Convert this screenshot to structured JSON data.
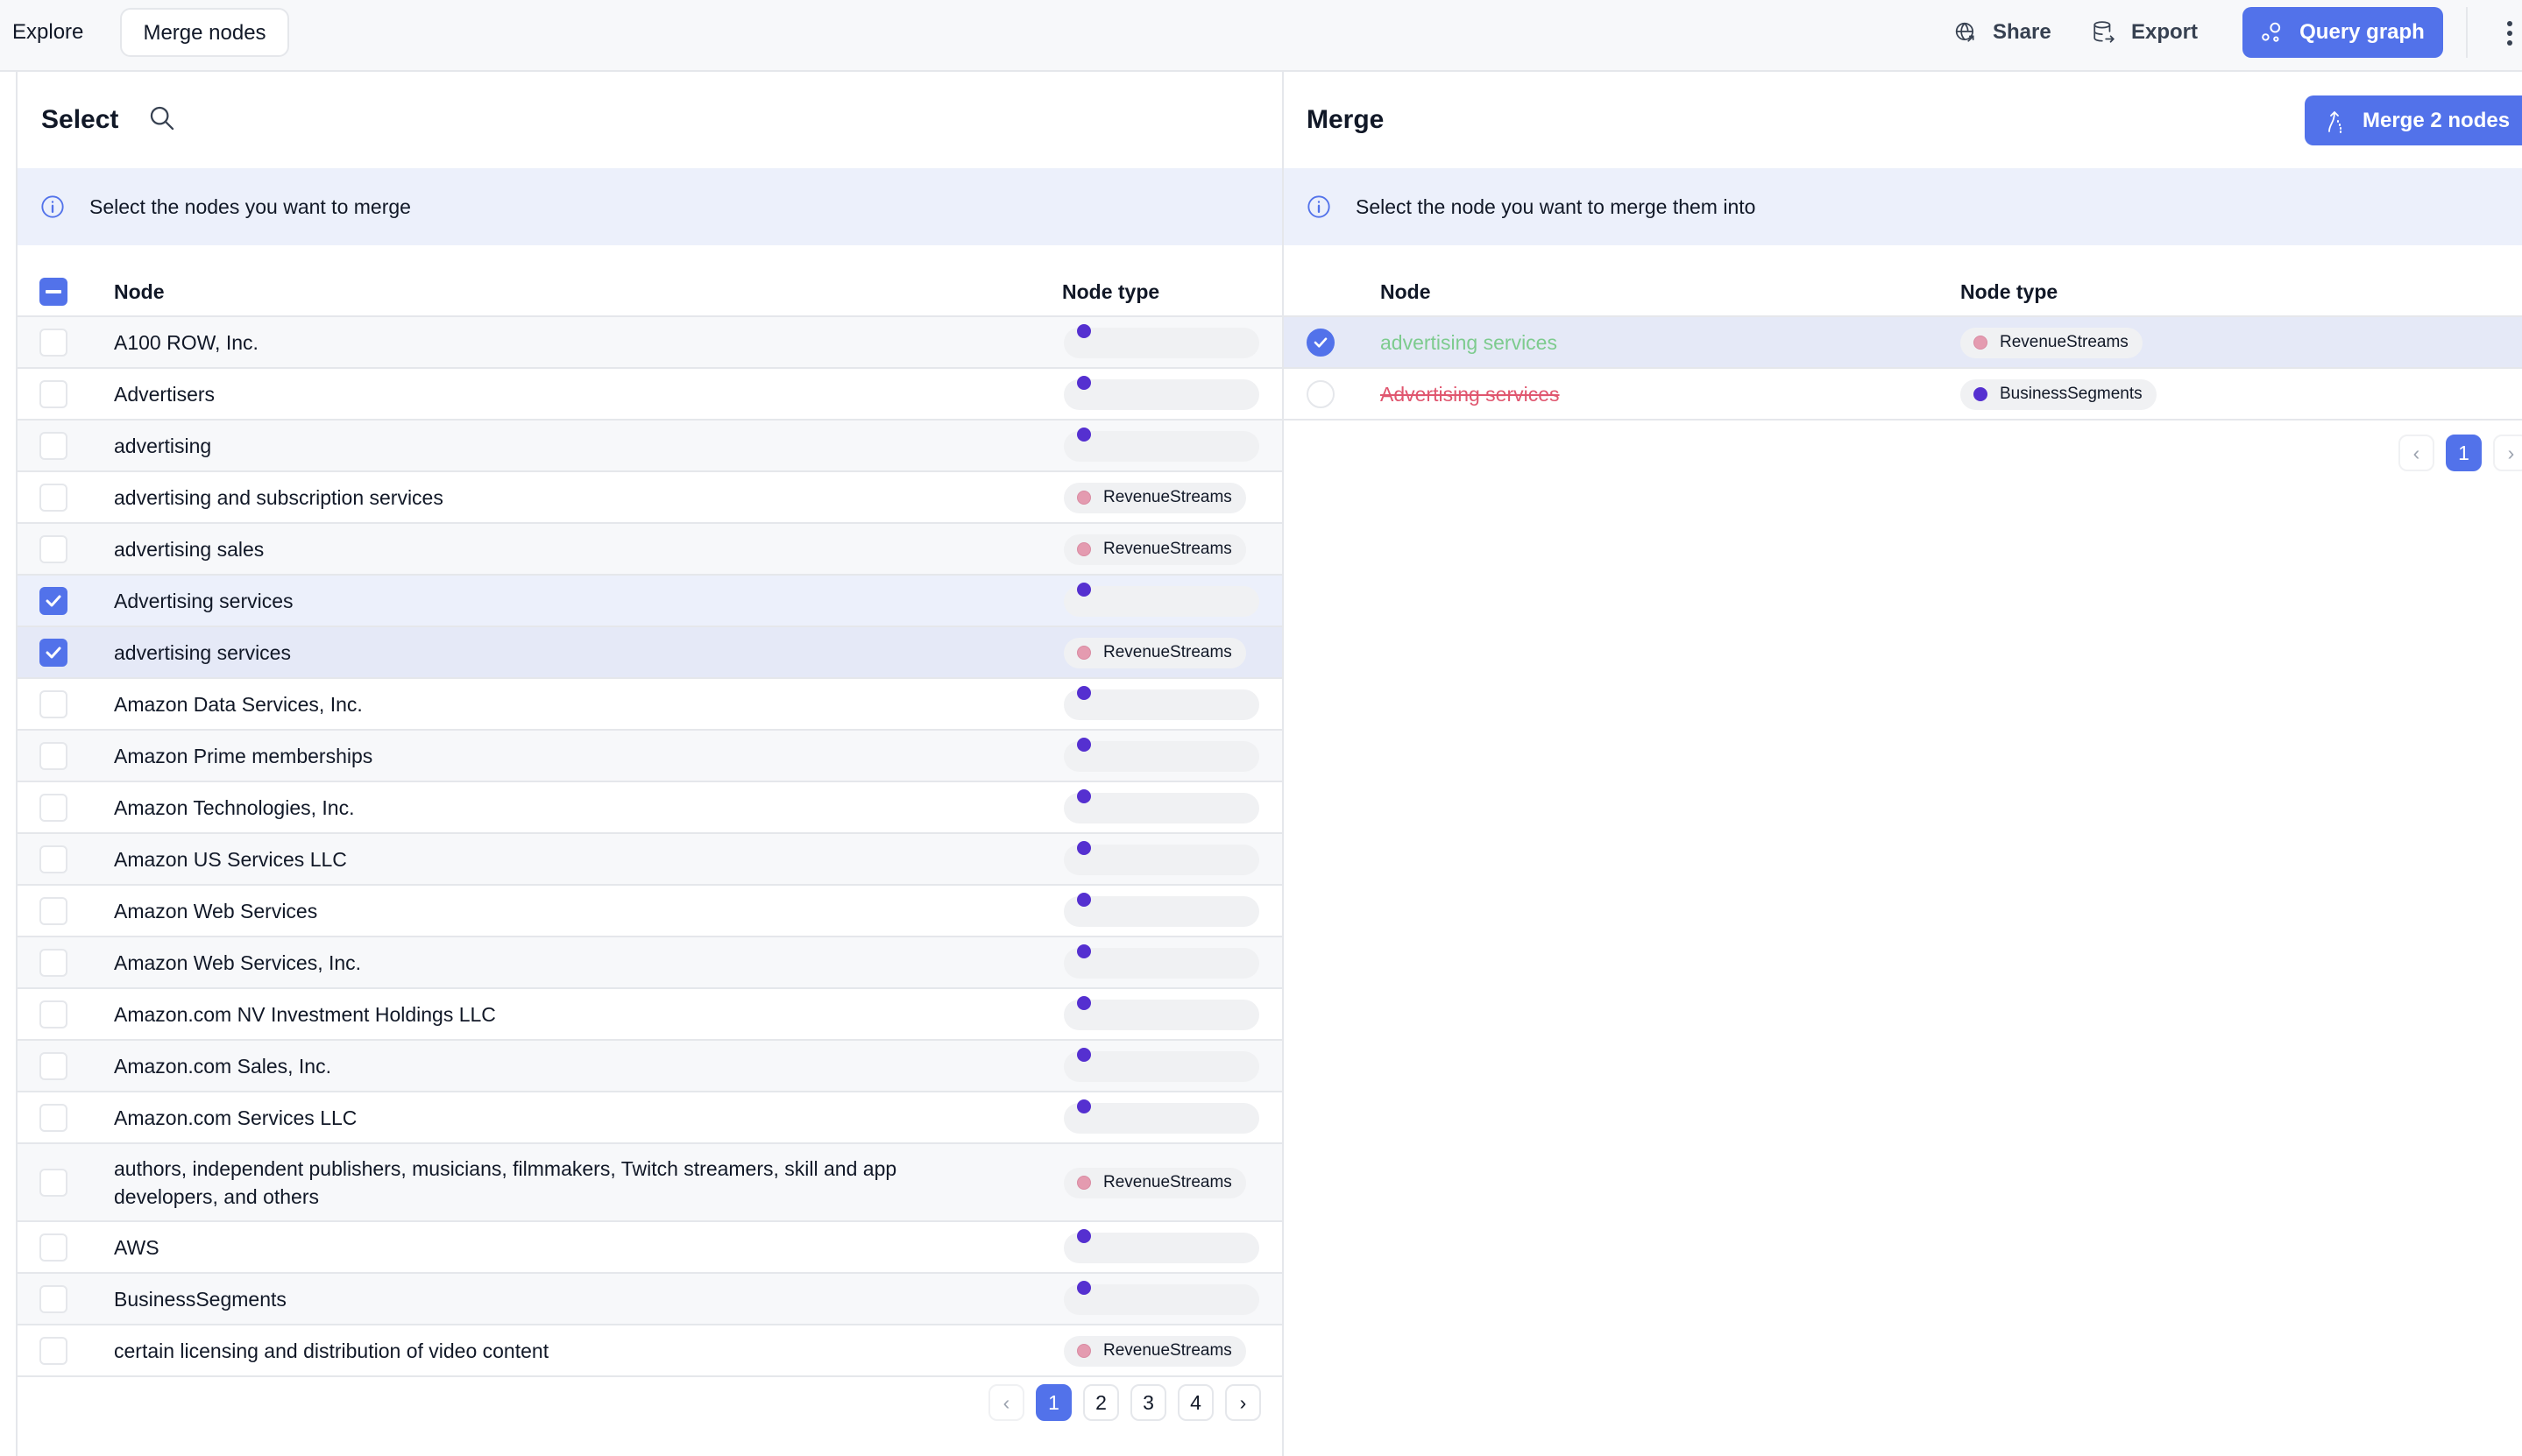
{
  "topbar": {
    "explore_label": "Explore",
    "active_tab_label": "Merge nodes",
    "share_label": "Share",
    "export_label": "Export",
    "query_graph_label": "Query graph"
  },
  "colors": {
    "accent": "#5272EA",
    "banner_bg": "#ECF0FB",
    "revenue_streams_dot": "#E49BB0",
    "business_segments_dot": "#5530D0",
    "keep_text": "#7DCB8E",
    "drop_text": "#E0566F"
  },
  "select_panel": {
    "title": "Select",
    "banner_text": "Select the nodes you want to merge",
    "columns": {
      "node": "Node",
      "node_type": "Node type"
    },
    "header_checkbox_state": "indeterminate",
    "rows": [
      {
        "node": "A100 ROW, Inc.",
        "node_type": "",
        "dot": "biz",
        "checked": false
      },
      {
        "node": "Advertisers",
        "node_type": "",
        "dot": "biz",
        "checked": false
      },
      {
        "node": "advertising",
        "node_type": "",
        "dot": "biz",
        "checked": false
      },
      {
        "node": "advertising and subscription services",
        "node_type": "RevenueStreams",
        "dot": "rev",
        "checked": false
      },
      {
        "node": "advertising sales",
        "node_type": "RevenueStreams",
        "dot": "rev",
        "checked": false
      },
      {
        "node": "Advertising services",
        "node_type": "",
        "dot": "biz",
        "checked": true
      },
      {
        "node": "advertising services",
        "node_type": "RevenueStreams",
        "dot": "rev",
        "checked": true
      },
      {
        "node": "Amazon Data Services, Inc.",
        "node_type": "",
        "dot": "biz",
        "checked": false
      },
      {
        "node": "Amazon Prime memberships",
        "node_type": "",
        "dot": "biz",
        "checked": false
      },
      {
        "node": "Amazon Technologies, Inc.",
        "node_type": "",
        "dot": "biz",
        "checked": false
      },
      {
        "node": "Amazon US Services LLC",
        "node_type": "",
        "dot": "biz",
        "checked": false
      },
      {
        "node": "Amazon Web Services",
        "node_type": "",
        "dot": "biz",
        "checked": false
      },
      {
        "node": "Amazon Web Services, Inc.",
        "node_type": "",
        "dot": "biz",
        "checked": false
      },
      {
        "node": "Amazon.com NV Investment Holdings LLC",
        "node_type": "",
        "dot": "biz",
        "checked": false
      },
      {
        "node": "Amazon.com Sales, Inc.",
        "node_type": "",
        "dot": "biz",
        "checked": false
      },
      {
        "node": "Amazon.com Services LLC",
        "node_type": "",
        "dot": "biz",
        "checked": false
      },
      {
        "node": "authors, independent publishers, musicians, filmmakers, Twitch streamers, skill and app developers, and others",
        "node_type": "RevenueStreams",
        "dot": "rev",
        "checked": false
      },
      {
        "node": "AWS",
        "node_type": "",
        "dot": "biz",
        "checked": false
      },
      {
        "node": "BusinessSegments",
        "node_type": "",
        "dot": "biz",
        "checked": false
      },
      {
        "node": "certain licensing and distribution of video content",
        "node_type": "RevenueStreams",
        "dot": "rev",
        "checked": false
      }
    ],
    "pagination": {
      "pages": [
        "1",
        "2",
        "3",
        "4"
      ],
      "current": "1",
      "prev": "‹",
      "next": "›"
    }
  },
  "merge_panel": {
    "title": "Merge",
    "merge_button_label": "Merge 2 nodes",
    "banner_text": "Select the node you want to merge them into",
    "columns": {
      "node": "Node",
      "node_type": "Node type"
    },
    "rows": [
      {
        "node": "advertising services",
        "node_type": "RevenueStreams",
        "dot": "rev",
        "selected": true,
        "state": "keep"
      },
      {
        "node": "Advertising services",
        "node_type": "BusinessSegments",
        "dot": "biz",
        "selected": false,
        "state": "drop"
      }
    ],
    "pagination": {
      "pages": [
        "1"
      ],
      "current": "1",
      "prev": "‹",
      "next": "›"
    }
  }
}
